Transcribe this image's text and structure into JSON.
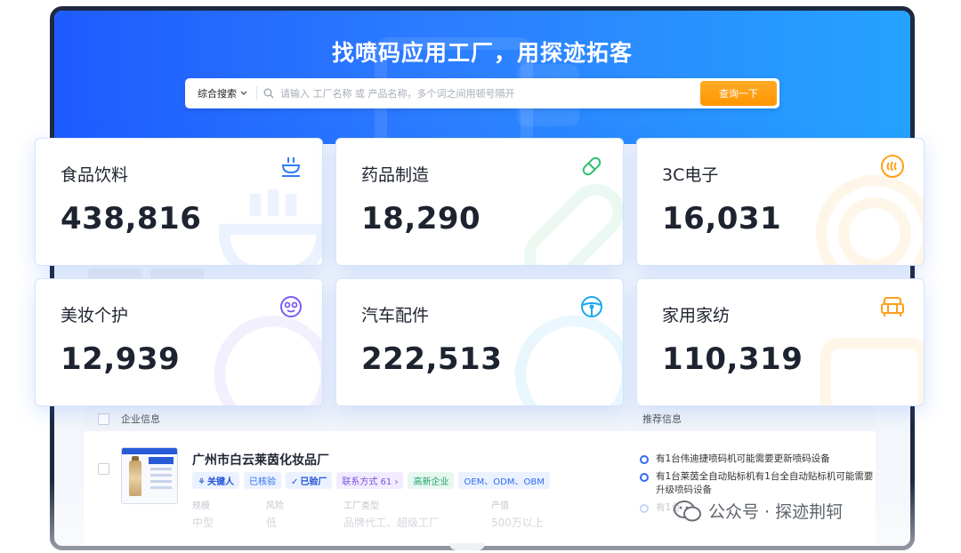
{
  "hero": {
    "title": "找喷码应用工厂，用探迹拓客"
  },
  "search": {
    "type_label": "综合搜索",
    "placeholder": "请输入 工厂名称 或 产品名称，多个词之间用顿号隔开",
    "button_label": "查询一下"
  },
  "categories": [
    {
      "label": "食品饮料",
      "value": "438,816",
      "icon": "bowl-icon",
      "color": "#2f7cf6"
    },
    {
      "label": "药品制造",
      "value": "18,290",
      "icon": "pill-icon",
      "color": "#2fbf71"
    },
    {
      "label": "3C电子",
      "value": "16,031",
      "icon": "signal-arcs-icon",
      "color": "#ff9f1a"
    },
    {
      "label": "美妆个护",
      "value": "12,939",
      "icon": "face-icon",
      "color": "#7a5af5"
    },
    {
      "label": "汽车配件",
      "value": "222,513",
      "icon": "steering-wheel-icon",
      "color": "#18a8f0"
    },
    {
      "label": "家用家纺",
      "value": "110,319",
      "icon": "sofa-icon",
      "color": "#ff9f1a"
    }
  ],
  "table": {
    "col_company": "企业信息",
    "col_recommend": "推荐信息",
    "row": {
      "company_name": "广州市白云莱茵化妆品厂",
      "tags": {
        "key_person": "关键人",
        "verified": "已核验",
        "visited": "已验厂",
        "contact": "联系方式 61",
        "high_tech": "高新企业",
        "oem": "OEM、ODM、OBM"
      },
      "meta": [
        {
          "label": "规模",
          "value": "中型"
        },
        {
          "label": "风险",
          "value": "低"
        },
        {
          "label": "工厂类型",
          "value": "品牌代工、超级工厂"
        },
        {
          "label": "产值",
          "value": "500万以上"
        }
      ]
    },
    "recommendations": [
      "有1台伟迪捷喷码机可能需要更新喷码设备",
      "有1台莱茵全自动贴标机有1台全自动贴标机可能需要升级喷码设备",
      "有1台..."
    ]
  },
  "watermark": {
    "text": "公众号 · 探迹荆轲"
  }
}
